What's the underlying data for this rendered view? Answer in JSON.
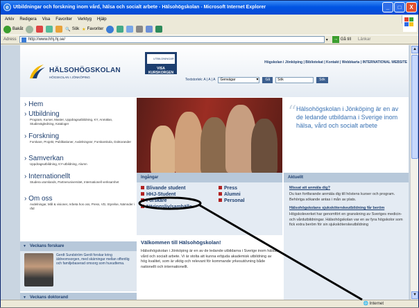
{
  "window": {
    "title": "Utbildningar och forskning inom vård, hälsa och socialt arbete - Hälsohögskolan - Microsoft Internet Explorer",
    "controls": [
      "_",
      "□",
      "X"
    ]
  },
  "menubar": {
    "items": [
      "Arkiv",
      "Redigera",
      "Visa",
      "Favoriter",
      "Verktyg",
      "Hjälp"
    ]
  },
  "toolbar": {
    "back": "Bakåt",
    "search": "Sök",
    "favorites": "Favoriter"
  },
  "addressbar": {
    "label": "Adress",
    "url": "http://www.hhj.hj.se/",
    "go": "Gå till",
    "links": "Länkar"
  },
  "site": {
    "logo_name": "HÄLSOHÖGSKOLAN",
    "logo_sub": "HÖGSKOLAN I JÖNKÖPING",
    "promo_top": "UTBILDNINGAR",
    "promo_label": "VISA KURSKORGEN",
    "topnav": "Högskolan i Jönköping | Bibliotekat | Kontakt | Webbkarta | INTERNATIONAL WEBSITE",
    "textsize_label": "Textstorlek: A | A | A",
    "shortcuts_value": "Genvägar",
    "shortcuts_go": "Gå",
    "search_value": "Sök",
    "search_button": "Sök"
  },
  "leftnav": [
    {
      "title": "Hem",
      "desc": ""
    },
    {
      "title": "Utbildning",
      "desc": "Program, Kurser, Master, Uppdragsutbildning, KY, Anmälan, Studievägledning, Kataloger"
    },
    {
      "title": "Forskning",
      "desc": "Forskare, Projekt, Publikationer, Avdelningsnr, Forskarskola, Doktorander"
    },
    {
      "title": "Samverkan",
      "desc": "Uppdragsutbildning, KY-utbildning, Alumn"
    },
    {
      "title": "Internationellt",
      "desc": "Studera utomlands, Partneruniversitet, Internationell verksamhet"
    },
    {
      "title": "Om oss",
      "desc": "Avdelningar, Mål & visioner, Arbeta hos oss, Press, VD, Styrelse, Nämnder i råd"
    }
  ],
  "forskare": {
    "heading": "Veckans forskare",
    "text": "Gerdt Sundström Gerdt forskar kring äldreomsorgen, med skärningar mellan offentlig och familjebaserad omsorg som huvudtema."
  },
  "doktorand": {
    "heading": "Veckans doktorand"
  },
  "hero": {
    "quote": "Hälsohögskolan i Jönköping är en av de ledande utbildarna i Sverige inom hälsa, vård och socialt arbete"
  },
  "ingangar": {
    "heading": "Ingångar",
    "left": [
      "Blivande student",
      "HHJ-Student",
      "Forskare",
      "Näringsliv/samhälle"
    ],
    "right": [
      "Press",
      "Alumni",
      "Personal"
    ]
  },
  "welcome": {
    "heading": "Välkommen till Hälsohögskolan!",
    "text": "Hälsohögskolan i Jönköping är en av de ledande utbildarna i Sverige inom hälsa, vård och socialt arbete. Vi är stolta att kunna erbjuda akademisk utbildning av hög kvalitet, som är viktig och relevant för kommande yrkesutövning både nationellt och internationellt."
  },
  "aktuellt": {
    "heading": "Aktuellt",
    "items": [
      {
        "link": "Missat att anmäla dig?",
        "text": "Du kan fortfarande anmäla dig till höstens kurser och program. Behöriga sökande antas i mån av plats."
      },
      {
        "link": "Hälsohögskolans sjuksköterskeutbildning får beröm",
        "text": "Högskoleverket har genomfört en granskning av Sveriges medicin- och vårdutbildningar. Hälsohögskolan var en av fyra högskolor som fick extra beröm för sin sjuksköterskeutbildning"
      }
    ]
  },
  "statusbar": {
    "zone": "Internet"
  },
  "colors": {
    "titlebar": "#0054e3",
    "brand": "#1e3f6f",
    "accent_red": "#b22222",
    "annotation": "#000000"
  }
}
